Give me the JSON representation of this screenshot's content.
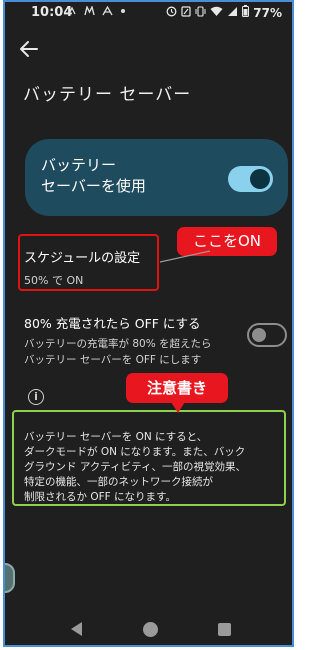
{
  "status_bar": {
    "time": "10:04",
    "battery": "77%",
    "icons_left": [
      "nfc-icon",
      "mastodon-icon",
      "a-icon",
      "dot-icon"
    ],
    "icons_right": [
      "alarm-icon",
      "sim-icon",
      "vibrate-icon",
      "wifi-icon",
      "signal-icon",
      "battery-icon"
    ]
  },
  "header": {
    "title": "バッテリー セーバー"
  },
  "main_card": {
    "label": "バッテリー\nセーバーを使用",
    "toggle_on": true
  },
  "schedule": {
    "title": "スケジュールの設定",
    "subtitle": "50% で ON"
  },
  "charge_80": {
    "title": "80% 充電されたら OFF にする",
    "description": "バッテリーの充電率が 80% を超えたら\nバッテリー セーバーを OFF にします",
    "toggle_on": false
  },
  "info": {
    "icon_glyph": "i",
    "text": "バッテリー セーバーを ON にすると、\nダークモードが ON になります。また、バック\nグラウンド アクティビティ、一部の視覚効果、\n特定の機能、一部のネットワーク接続が\n制限されるか OFF になります。"
  },
  "annotations": {
    "callout_on": "ここをON",
    "callout_note": "注意書き"
  },
  "colors": {
    "background": "#1f1f1f",
    "card": "#1f4b5e",
    "toggle_accent": "#8ad1ee",
    "callout_red": "#e8161e",
    "highlight_green": "#8fd14b"
  }
}
